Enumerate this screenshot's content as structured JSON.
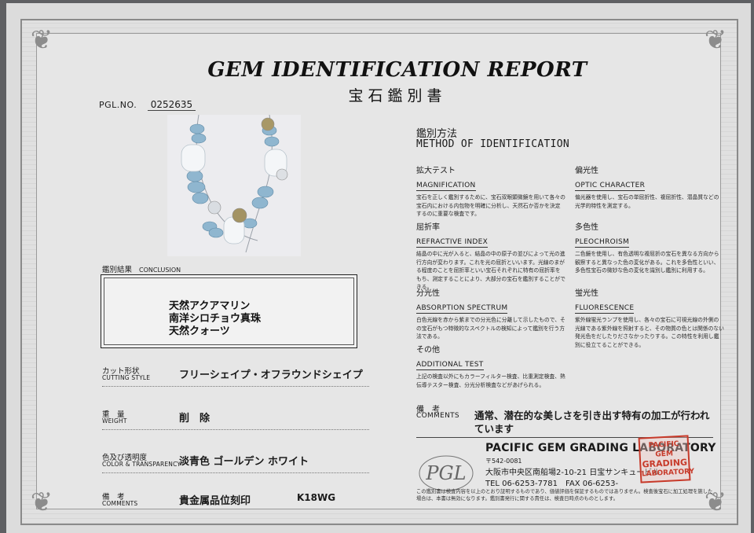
{
  "report": {
    "title": "GEM IDENTIFICATION REPORT",
    "subtitle": "宝石鑑別書",
    "pgl_no_label": "PGL.NO.",
    "pgl_no": "0252635"
  },
  "conclusion": {
    "label_jp": "鑑別結果",
    "label_en": "CONCLUSION",
    "lines": [
      "天然アクアマリン",
      "南洋シロチョウ真珠",
      "天然クォーツ"
    ]
  },
  "fields": [
    {
      "jp": "カット形状",
      "en": "CUTTING STYLE",
      "value": "フリーシェイプ・オフラウンドシェイプ"
    },
    {
      "jp": "重　量",
      "en": "WEIGHT",
      "value": "削　除"
    },
    {
      "jp": "色及び透明度",
      "en": "COLOR & TRANSPARENCY",
      "value": "淡青色 ゴールデン ホワイト"
    },
    {
      "jp": "備　考",
      "en": "COMMENTS",
      "value": "貴金属品位刻印",
      "extra": "K18WG"
    }
  ],
  "method": {
    "title_jp": "鑑別方法",
    "title_en": "METHOD OF IDENTIFICATION",
    "tests": [
      {
        "jp": "拡大テスト",
        "en": "MAGNIFICATION",
        "desc": "宝石を正しく鑑別するために、宝石双眼顕微鏡を用いて各々の宝石内における内包物を明確に分析し、天然石か否かを決定するのに重要な検査です。"
      },
      {
        "jp": "偏光性",
        "en": "OPTIC CHARACTER",
        "desc": "偏光器を使用し、宝石の単屈折性、複屈折性、潜晶質などの光学的特性を測定する。"
      },
      {
        "jp": "屈折率",
        "en": "REFRACTIVE INDEX",
        "desc": "結晶の中に光が入ると、結晶の中の原子の並びによって光の進行方向が変わります。これを光の屈折といいます。光線のまがる程度のことを屈折率といい宝石それぞれに特有の屈折率をもち、測定することにより、大部分の宝石を鑑別することができる。"
      },
      {
        "jp": "多色性",
        "en": "PLEOCHROISM",
        "desc": "二色鏡を使用し、有色透明な複屈折の宝石を異なる方向から観察すると異なった色の変化がある。これを多色性といい、多色性宝石の微妙な色の変化を識別し鑑別に利用する。"
      },
      {
        "jp": "分光性",
        "en": "ABSORPTION SPECTRUM",
        "desc": "白色光線を赤から紫までの分光色に分離して示したもので、その宝石がもつ特徴的なスペクトルの検知によって鑑別を行う方法である。"
      },
      {
        "jp": "蛍光性",
        "en": "FLUORESCENCE",
        "desc": "紫外線蛍光ランプを使用し、各々の宝石に可視光線の外側の光線である紫外線を照射すると、その物質の色とは関係のない発光色をだしたりださなかったりする。この特性を利用し鑑別に役立てることができる。"
      },
      {
        "jp": "その他",
        "en": "ADDITIONAL TEST",
        "desc": "上記の検査以外にもカラーフィルター検査、比重測定検査、熱伝導テスター検査、分光分析検査などがあげられる。"
      }
    ]
  },
  "remarks": {
    "label_jp": "備　考",
    "label_en": "COMMENTS",
    "text": "通常、潜在的な美しさを引き出す特有の加工が行われています"
  },
  "lab": {
    "logo_text": "PGL",
    "name": "PACIFIC GEM GRADING LABORATORY",
    "zip": "〒542-0081",
    "address": "大阪市中央区南船場2-10-21 日宝サンキュービル",
    "tel": "TEL 06-6253-7781　FAX 06-6253-",
    "stamp": [
      "PACIFIC GEM",
      "GRADING",
      "LABORATORY"
    ],
    "disclaimer": "この鑑別書は検査内容を以上のとおり証明するものであり、価値評価を保証するものではありません。検査後宝石に加工処理を施した場合は、本書は無効になります。鑑別書発行に関する責任は、検査日時点のものとします。"
  },
  "colors": {
    "stamp": "#c73a2a",
    "frame": "#8a8a8a"
  }
}
